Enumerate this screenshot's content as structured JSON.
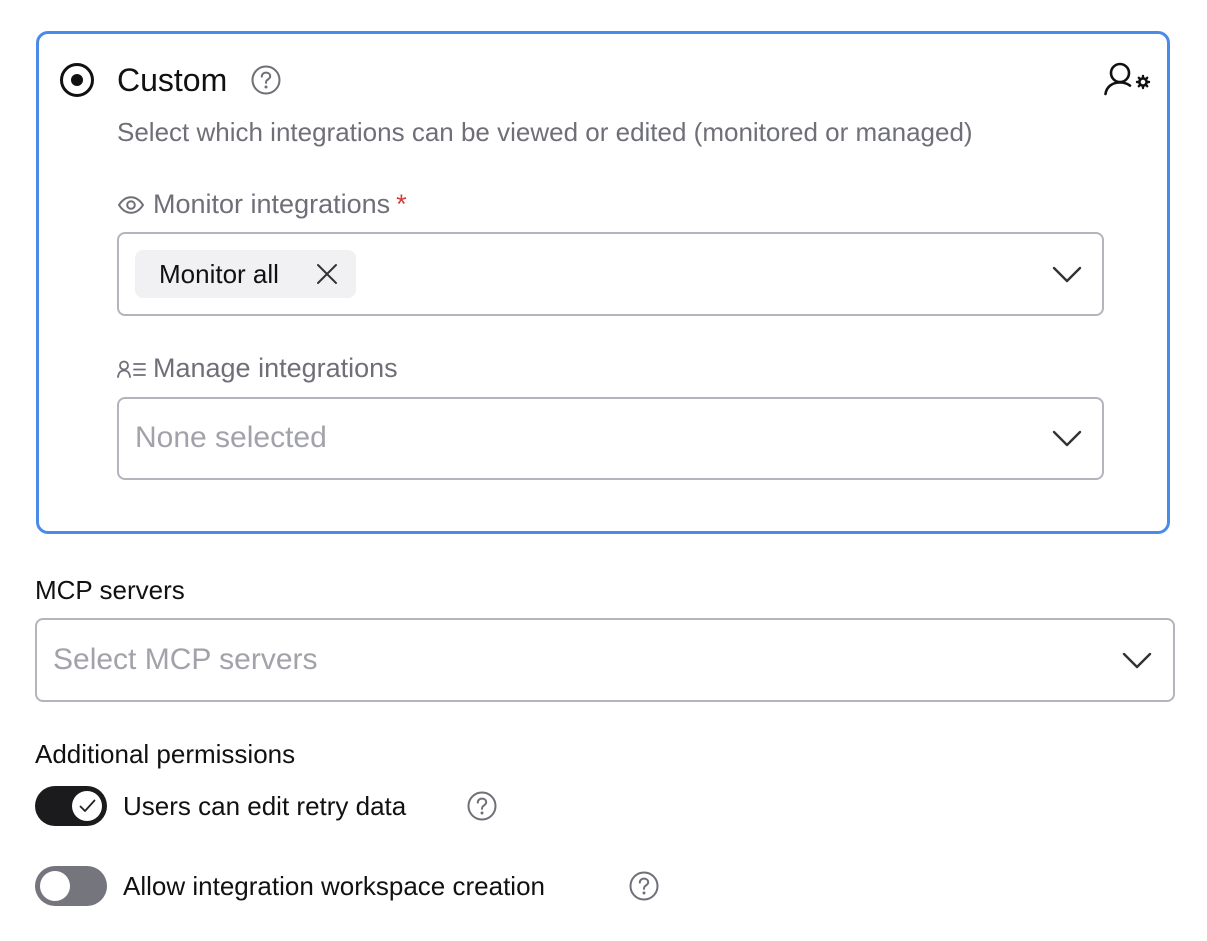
{
  "custom_option": {
    "title": "Custom",
    "selected": true,
    "subtitle": "Select which integrations can be viewed or edited (monitored or managed)",
    "icon": "user-settings-icon",
    "monitor": {
      "label": "Monitor integrations",
      "required_mark": "*",
      "icon": "eye-icon",
      "chips": [
        "Monitor all"
      ]
    },
    "manage": {
      "label": "Manage integrations",
      "icon": "user-list-icon",
      "placeholder": "None selected"
    }
  },
  "mcp": {
    "label": "MCP servers",
    "placeholder": "Select MCP servers"
  },
  "additional": {
    "title": "Additional permissions",
    "toggles": [
      {
        "label": "Users can edit retry data",
        "on": true
      },
      {
        "label": "Allow integration workspace creation",
        "on": false
      }
    ]
  },
  "colors": {
    "accent_border": "#4a8ae8",
    "required": "#d23b3b",
    "toggle_on": "#1b1b1d",
    "toggle_off": "#75757d"
  }
}
